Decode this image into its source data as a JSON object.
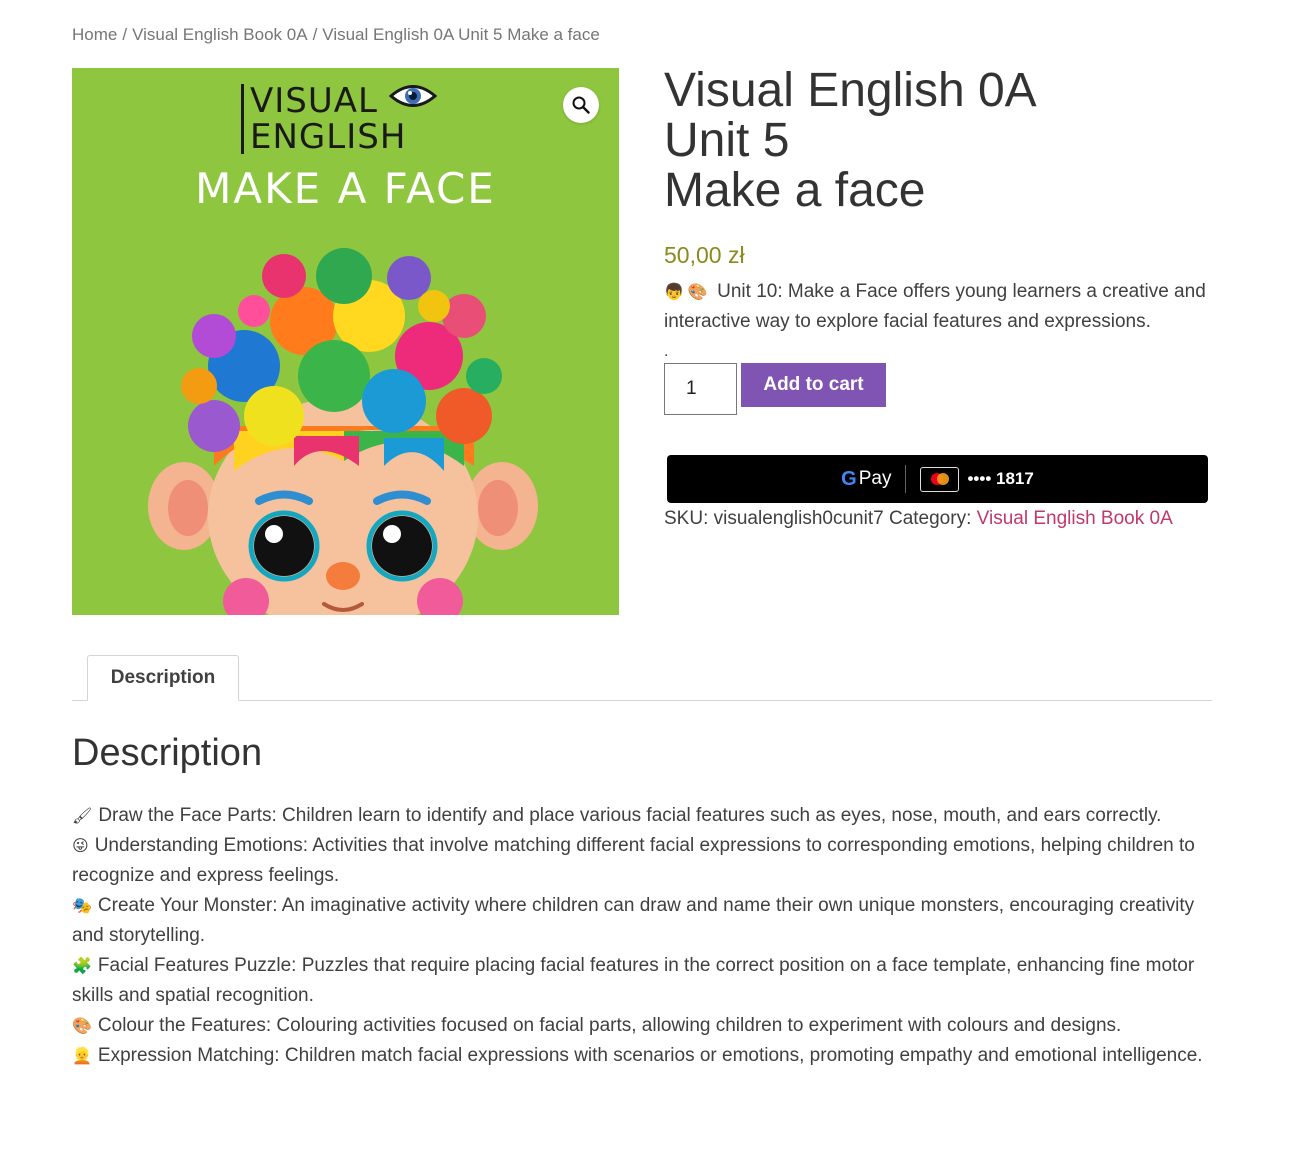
{
  "breadcrumb": {
    "home": "Home",
    "separator": "/",
    "category": "Visual English Book 0A",
    "current": "Visual English 0A Unit 5 Make a face"
  },
  "product_image": {
    "logo_line1": "VISUAL",
    "logo_line2": "ENGLISH",
    "cover_title": "MAKE A FACE",
    "background_color": "#8fc640",
    "zoom_icon": "magnifier-icon"
  },
  "product": {
    "title_lines": [
      "Visual English 0A",
      "Unit 5",
      "Make a face"
    ],
    "price": "50,00 zł",
    "short_description": "Unit 10: Make a Face offers young learners a creative and interactive way to explore facial features and expressions.",
    "short_description_emojis": [
      "👦",
      "🎨"
    ],
    "dot": ".",
    "quantity": "1",
    "add_to_cart": "Add to cart",
    "gpay": {
      "g": "G",
      "pay": "Pay",
      "card_number": "•••• 1817"
    },
    "sku_label": "SKU:",
    "sku": "visualenglish0cunit7",
    "category_label": "Category:",
    "category": "Visual English Book 0A"
  },
  "tabs": [
    {
      "label": "Description"
    }
  ],
  "description": {
    "heading": "Description",
    "items": [
      {
        "emoji": "🖌",
        "text": "Draw the Face Parts: Children learn to identify and place various facial features such as eyes, nose, mouth, and ears correctly."
      },
      {
        "emoji": "😜",
        "text": "Understanding Emotions: Activities that involve matching different facial expressions to corresponding emotions, helping children to recognize and express feelings."
      },
      {
        "emoji": "🎭",
        "text": "Create Your Monster: An imaginative activity where children can draw and name their own unique monsters, encouraging creativity and storytelling."
      },
      {
        "emoji": "🧩",
        "text": "Facial Features Puzzle: Puzzles that require placing facial features in the correct position on a face template, enhancing fine motor skills and spatial recognition."
      },
      {
        "emoji": "🎨",
        "text": "Colour the Features: Colouring activities focused on facial parts, allowing children to experiment with colours and designs."
      },
      {
        "emoji": "👱",
        "text": "Expression Matching: Children match facial expressions with scenarios or emotions, promoting empathy and emotional intelligence."
      }
    ]
  },
  "colors": {
    "accent_purple": "#7f54b3",
    "price_olive": "#8a8a1d",
    "link_pink": "#c1386a"
  }
}
